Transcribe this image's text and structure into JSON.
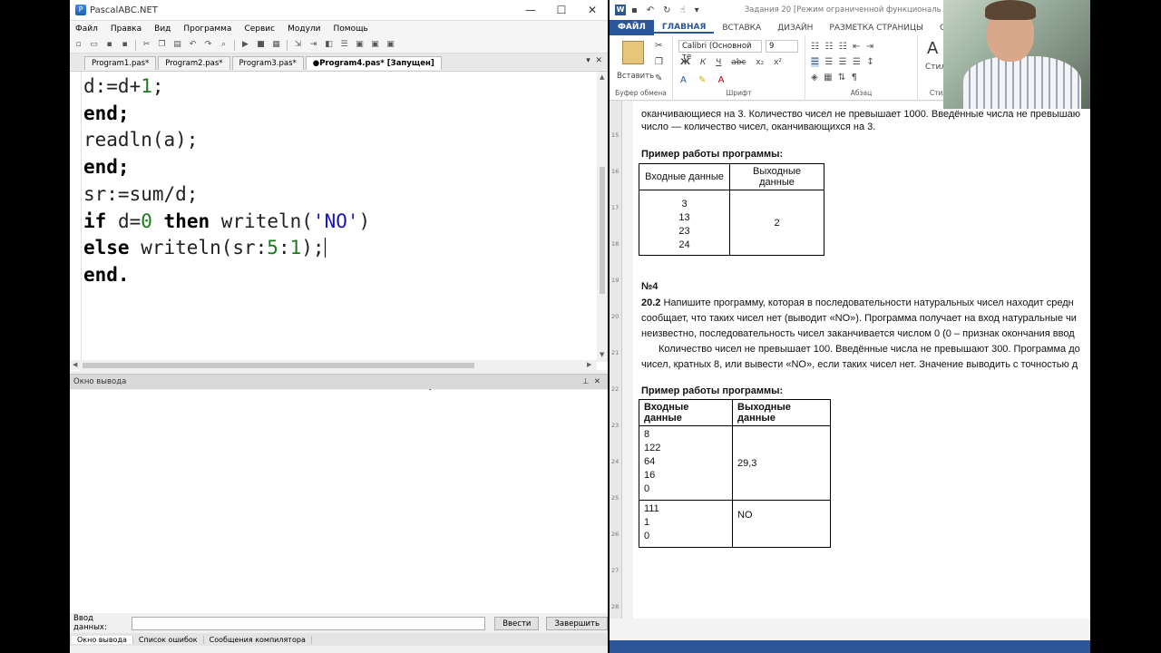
{
  "pascal": {
    "title": "PascalABC.NET",
    "menu": [
      "Файл",
      "Правка",
      "Вид",
      "Программа",
      "Сервис",
      "Модули",
      "Помощь"
    ],
    "tabs": [
      "Program1.pas*",
      "Program2.pas*",
      "Program3.pas*",
      "●Program4.pas* [Запущен]"
    ],
    "code_lines": [
      "d:=d+1;",
      "end;",
      "readln(a);",
      "end;",
      "sr:=sum/d;",
      "if d=0 then writeln('NO')",
      "else writeln(sr:5:1);",
      "end."
    ],
    "output_title": "Окно вывода",
    "input_label": "Ввод данных:",
    "input_value": "",
    "btn_enter": "Ввести",
    "btn_stop": "Завершить",
    "bottom_tabs": [
      "Окно вывода",
      "Список ошибок",
      "Сообщения компилятора"
    ]
  },
  "word": {
    "title": "Задания 20 [Режим ограниченной функциональ",
    "tabs": [
      "ФАЙЛ",
      "ГЛАВНАЯ",
      "ВСТАВКА",
      "ДИЗАЙН",
      "РАЗМЕТКА СТРАНИЦЫ",
      "ССЬ"
    ],
    "paste_label": "Вставить",
    "font_name": "Calibri (Основной те",
    "font_size": "9",
    "fmt_buttons": [
      "Ж",
      "К",
      "Ч",
      "abc",
      "x₂",
      "x²"
    ],
    "groups": [
      "Буфер обмена",
      "Шрифт",
      "Абзац",
      "Стили"
    ],
    "styles_label": "Стили",
    "doc": {
      "line_top": "оканчивающиеся на 3. Количество чисел не превышает 1000. Введённые числа не превышаю",
      "line_top2": "число — количество чисел, оканчивающихся на 3.",
      "example_title": "Пример работы программы:",
      "table1": {
        "headers": [
          "Входные данные",
          "Выходные данные"
        ],
        "input": [
          "3",
          "13",
          "23",
          "24"
        ],
        "output": "2"
      },
      "task_no": "№4",
      "task_num": "20.2",
      "task_lines": [
        "Напишите программу, которая в последовательности натуральных чисел находит средн",
        "сообщает, что таких чисел нет (выводит «NO»). Программа получает на вход натуральные чи",
        "неизвестно, последовательность чисел заканчивается числом 0 (0 – признак окончания ввод",
        "Количество чисел не превышает 100. Введённые числа не превышают 300. Программа до",
        "чисел, кратных 8, или вывести «NO», если таких чисел нет. Значение выводить с точностью д"
      ],
      "example_title2": "Пример работы программы:",
      "table2": {
        "headers": [
          "Входные данные",
          "Выходные данные"
        ],
        "rows": [
          {
            "input": [
              "8",
              "122",
              "64",
              "16",
              "0"
            ],
            "output": "29,3"
          },
          {
            "input": [
              "111",
              "1",
              "0"
            ],
            "output": "NO"
          }
        ]
      }
    },
    "ruler_marks": [
      "15",
      "16",
      "17",
      "18",
      "19",
      "20",
      "21",
      "22",
      "23",
      "24",
      "25",
      "26",
      "27",
      "28"
    ]
  }
}
